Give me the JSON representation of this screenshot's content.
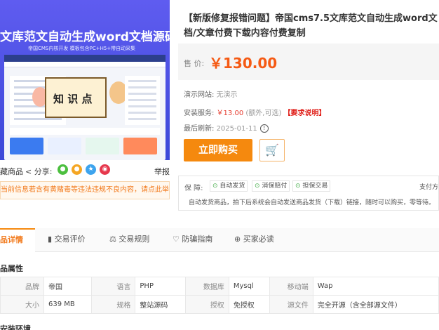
{
  "image": {
    "headline": "文库范文自动生成word文档源码整站",
    "subhead": "帝国CMS内核开发  模板包含PC+H5+带自动采集",
    "board_text": "知 识 点"
  },
  "share": {
    "favorite": "藏商品",
    "share_label": "分享:",
    "report": "举报",
    "icons": [
      "wechat-icon",
      "qq-icon",
      "qzone-icon",
      "weibo-icon"
    ]
  },
  "warning": "当前信息若含有黄赌毒等违法违规不良内容，请点此举报！",
  "product": {
    "title": "【新版修复报错问题】帝国cms7.5文库范文自动生成word文档/文章付费下载内容付费复制",
    "price_label": "售  价:",
    "price": "￥130.00",
    "demo_label": "演示网站:",
    "demo_value": "无演示",
    "install_label": "安装服务:",
    "install_price": "￥13.00",
    "install_note": "(额外,可选)",
    "install_tag": "【要求说明】",
    "refresh_label": "最后刷新:",
    "refresh_value": "2025-01-11",
    "buy_label": "立即购买"
  },
  "guarantee": {
    "label": "保  障:",
    "items": [
      "自动发货",
      "消保赔付",
      "担保交易"
    ],
    "pay": "支付方",
    "desc": "自动发货商品，拍下后系统会自动发送商品发货（下载）链接，随时可以购买，零等待。"
  },
  "tabs": [
    "品详情",
    "交易评价",
    "交易规则",
    "防骗指南",
    "买家必读"
  ],
  "sections": {
    "attributes": "品属性",
    "install_env": "安装环境"
  },
  "attributes": [
    [
      [
        "品牌",
        "帝国"
      ],
      [
        "语言",
        "PHP"
      ],
      [
        "数据库",
        "Mysql"
      ],
      [
        "移动端",
        "Wap"
      ]
    ],
    [
      [
        "大小",
        "639 MB"
      ],
      [
        "规格",
        "整站源码"
      ],
      [
        "授权",
        "免授权"
      ],
      [
        "源文件",
        "完全开源（含全部源文件）"
      ]
    ]
  ],
  "colors": {
    "accent": "#f5890e",
    "price": "#f55a14",
    "warn": "#f27b1e"
  }
}
